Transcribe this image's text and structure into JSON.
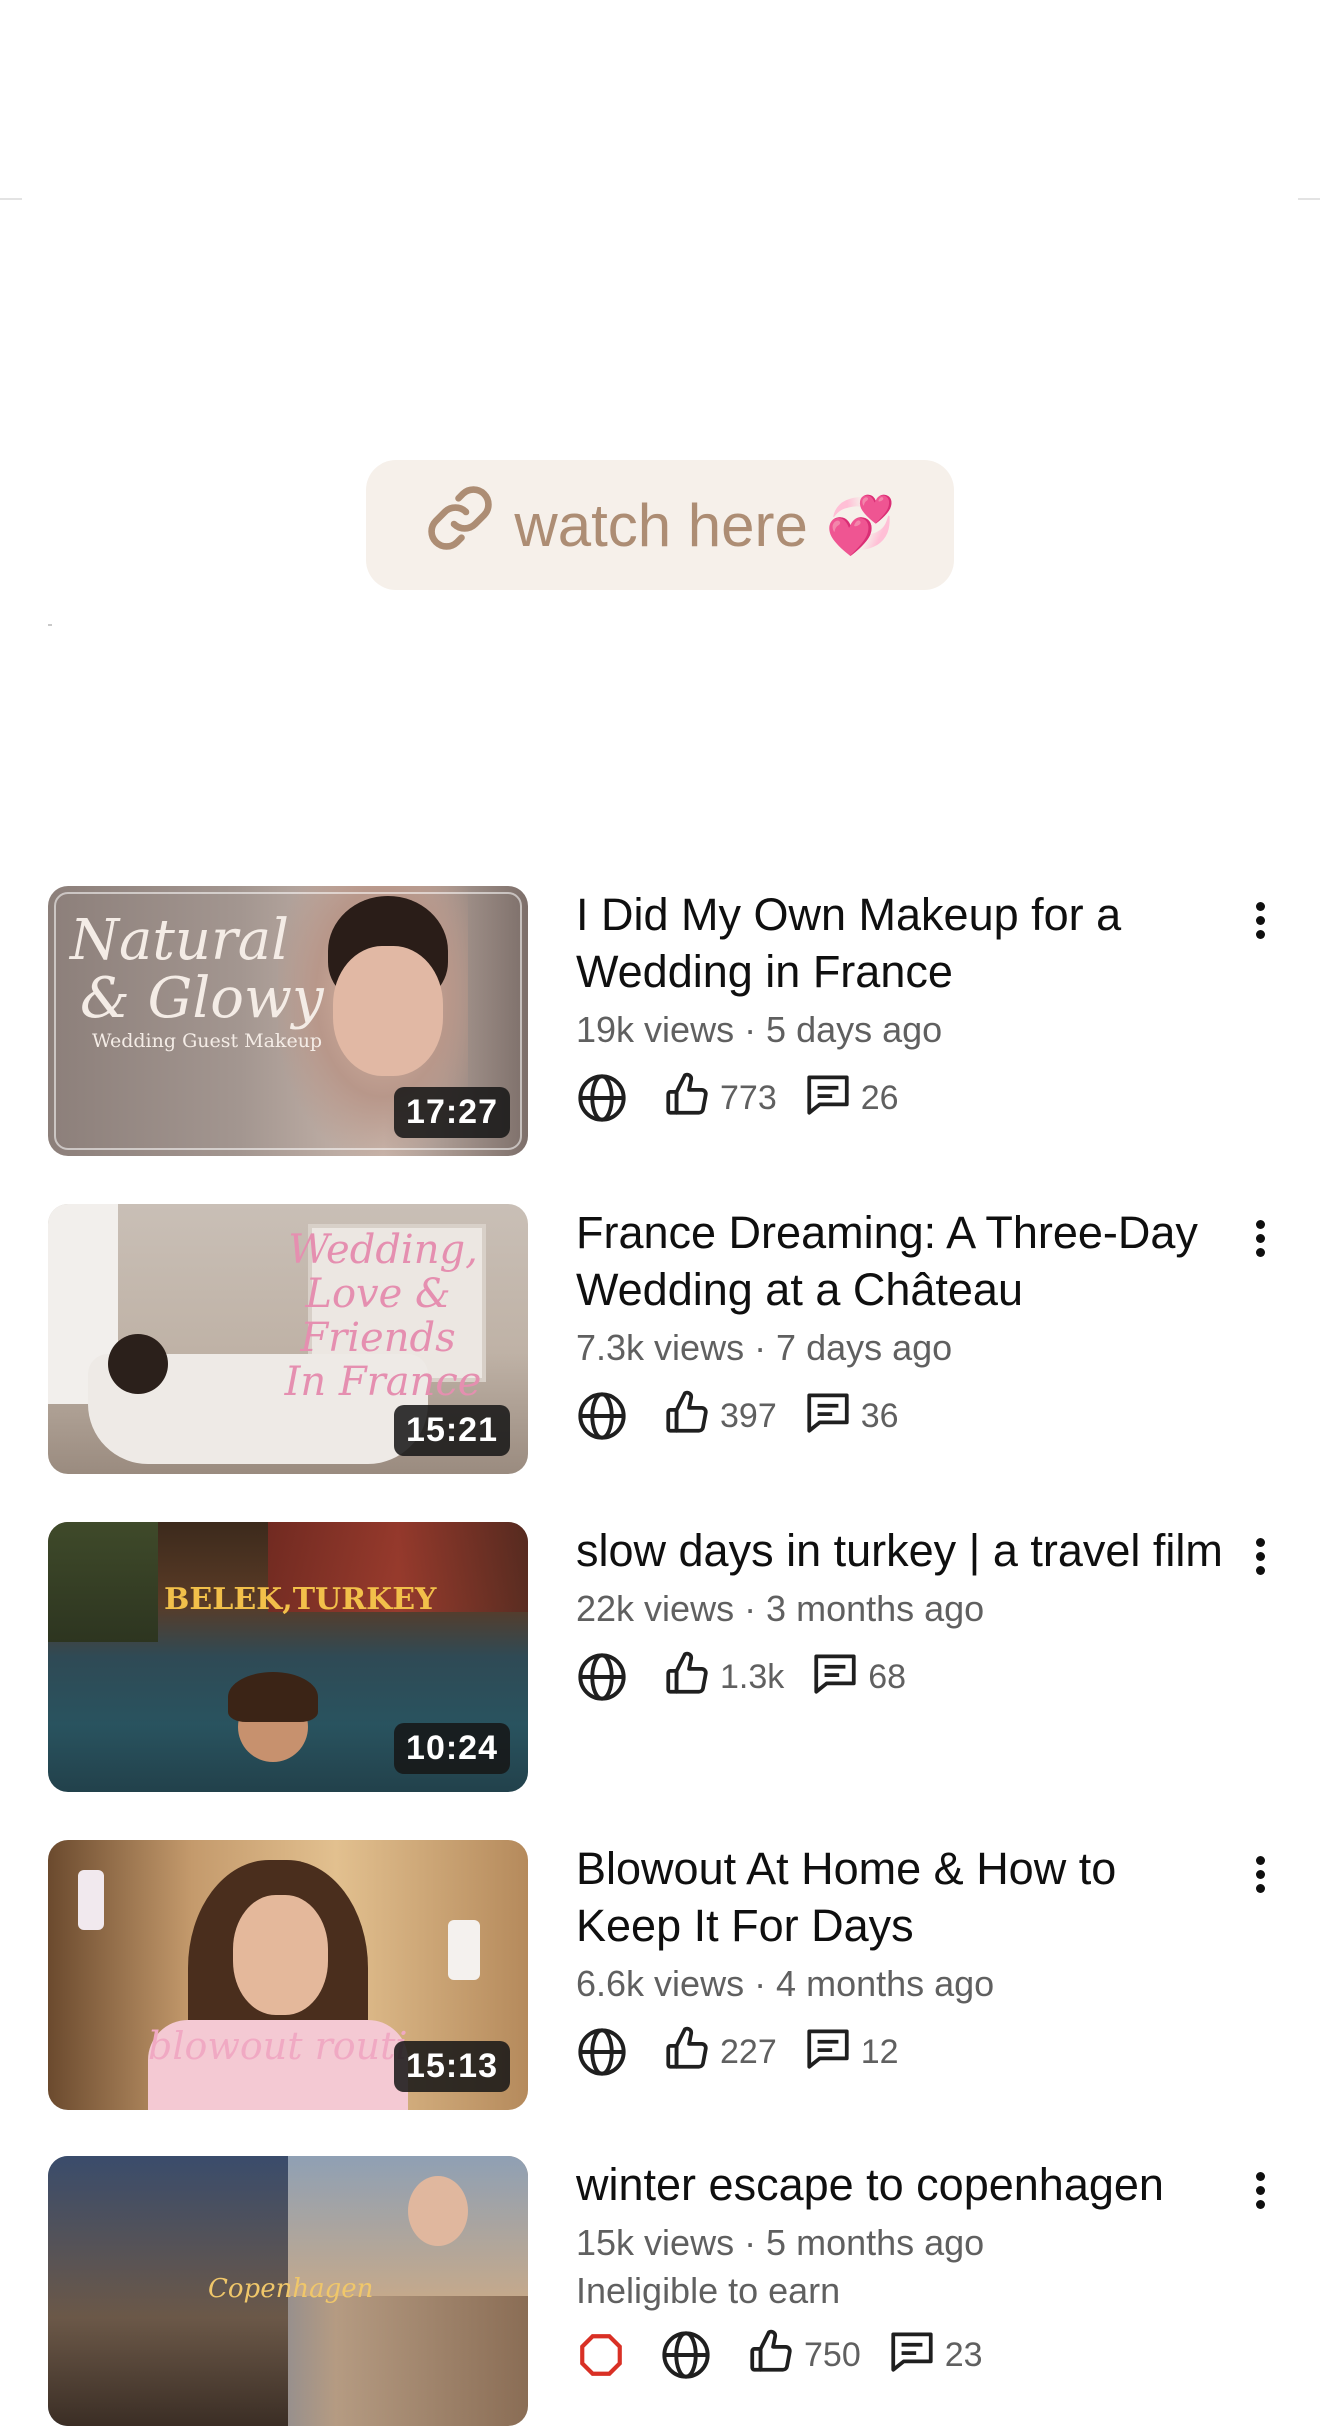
{
  "link_button": {
    "label": "watch here",
    "emoji": "💞",
    "icon": "link-icon"
  },
  "videos": [
    {
      "title": "I Did My Own Makeup for a Wedding in France",
      "meta": "19k views · 5 days ago",
      "duration": "17:27",
      "likes": "773",
      "comments": "26",
      "thumb_text": {
        "line1": "Natural",
        "line2": "& Glowy",
        "line3": "Wedding Guest Makeup"
      }
    },
    {
      "title": "France Dreaming: A Three-Day Wedding at a Château",
      "meta": "7.3k views · 7 days ago",
      "duration": "15:21",
      "likes": "397",
      "comments": "36",
      "thumb_text": {
        "line1": "Wedding,",
        "line2": "Love & Friends",
        "line3": "In France"
      }
    },
    {
      "title": "slow days in turkey | a travel film",
      "meta": "22k views · 3 months ago",
      "duration": "10:24",
      "likes": "1.3k",
      "comments": "68",
      "thumb_text": {
        "line1": "BELEK,TURKEY"
      }
    },
    {
      "title": "Blowout At Home & How to Keep It For Days",
      "meta": "6.6k views · 4 months ago",
      "duration": "15:13",
      "likes": "227",
      "comments": "12",
      "thumb_text": {
        "line1": "blowout routi"
      }
    },
    {
      "title": "winter escape to copenhagen",
      "meta": "15k views · 5 months ago",
      "status": "Ineligible to earn",
      "likes": "750",
      "comments": "23",
      "thumb_text": {
        "line1": "Copenhagen"
      }
    }
  ],
  "colors": {
    "button_bg": "#f6f0ea",
    "button_text": "#ad8d74",
    "meta": "#606060"
  }
}
